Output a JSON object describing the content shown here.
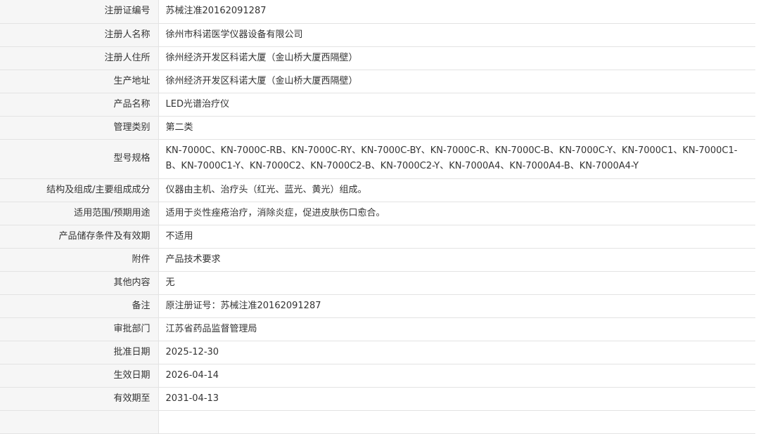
{
  "rows": [
    {
      "label": "注册证编号",
      "value": "苏械注准20162091287"
    },
    {
      "label": "注册人名称",
      "value": "徐州市科诺医学仪器设备有限公司"
    },
    {
      "label": "注册人住所",
      "value": "徐州经济开发区科诺大厦（金山桥大厦西隔壁）"
    },
    {
      "label": "生产地址",
      "value": "徐州经济开发区科诺大厦（金山桥大厦西隔壁）"
    },
    {
      "label": "产品名称",
      "value": "LED光谱治疗仪"
    },
    {
      "label": "管理类别",
      "value": "第二类"
    },
    {
      "label": "型号规格",
      "value": "KN-7000C、KN-7000C-RB、KN-7000C-RY、KN-7000C-BY、KN-7000C-R、KN-7000C-B、KN-7000C-Y、KN-7000C1、KN-7000C1-B、KN-7000C1-Y、KN-7000C2、KN-7000C2-B、KN-7000C2-Y、KN-7000A4、KN-7000A4-B、KN-7000A4-Y"
    },
    {
      "label": "结构及组成/主要组成成分",
      "value": "仪器由主机、治疗头（红光、蓝光、黄光）组成。"
    },
    {
      "label": "适用范围/预期用途",
      "value": "适用于炎性痤疮治疗，消除炎症，促进皮肤伤口愈合。"
    },
    {
      "label": "产品储存条件及有效期",
      "value": "不适用"
    },
    {
      "label": "附件",
      "value": "产品技术要求"
    },
    {
      "label": "其他内容",
      "value": "无"
    },
    {
      "label": "备注",
      "value": "原注册证号：苏械注准20162091287"
    },
    {
      "label": "审批部门",
      "value": "江苏省药品监督管理局"
    },
    {
      "label": "批准日期",
      "value": "2025-12-30"
    },
    {
      "label": "生效日期",
      "value": "2026-04-14"
    },
    {
      "label": "有效期至",
      "value": "2031-04-13"
    },
    {
      "label": "",
      "value": ""
    }
  ]
}
